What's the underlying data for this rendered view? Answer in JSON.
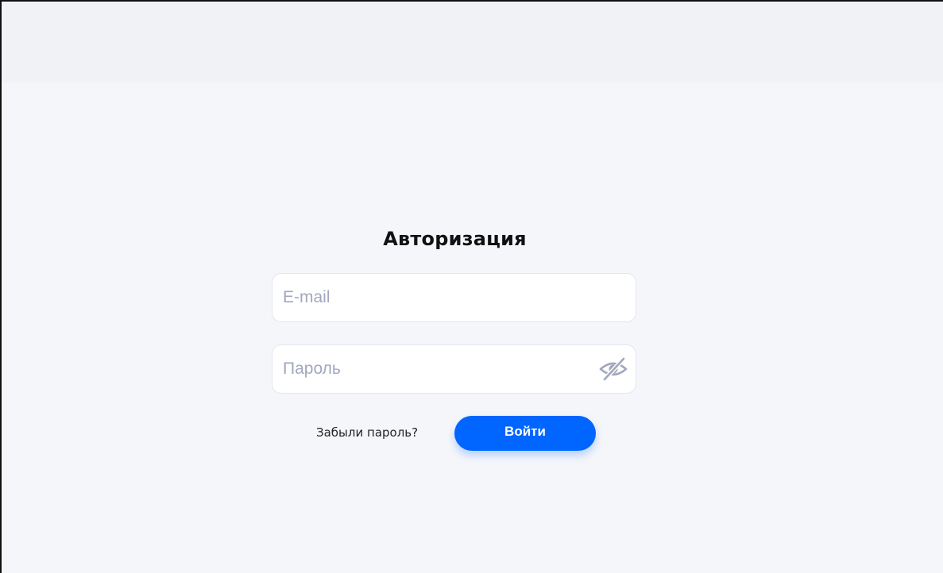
{
  "login": {
    "title": "Авторизация",
    "email": {
      "placeholder": "E-mail",
      "value": ""
    },
    "password": {
      "placeholder": "Пароль",
      "value": "",
      "toggle_icon": "eye-off-icon"
    },
    "forgot_label": "Забыли пароль?",
    "submit_label": "Войти"
  },
  "colors": {
    "page_background": "#f5f6fa",
    "header_background": "#f1f2f5",
    "accent": "#0066ff",
    "placeholder": "#a1a8bd",
    "field_border": "#e3e6ee"
  }
}
